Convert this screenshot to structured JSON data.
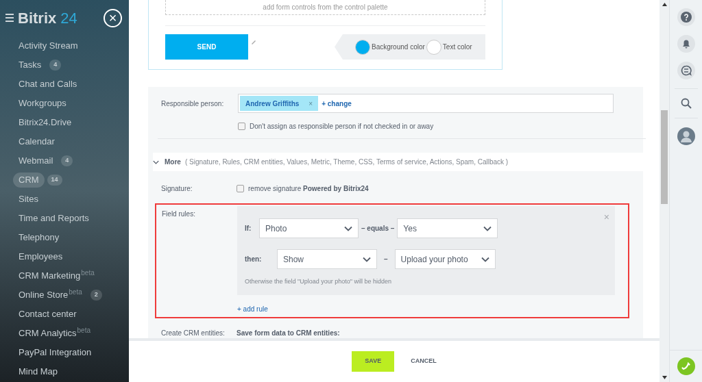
{
  "sidebar": {
    "logo_text": "Bitrix",
    "logo_number": "24",
    "close_symbol": "×",
    "items": [
      {
        "label": "Activity Stream",
        "selected": false
      },
      {
        "label": "Tasks",
        "counter": "4",
        "selected": false
      },
      {
        "label": "Chat and Calls",
        "selected": false
      },
      {
        "label": "Workgroups",
        "selected": false
      },
      {
        "label": "Bitrix24.Drive",
        "selected": false
      },
      {
        "label": "Calendar",
        "selected": false
      },
      {
        "label": "Webmail",
        "counter": "4",
        "selected": false
      },
      {
        "label": "CRM",
        "counter": "14",
        "selected": true
      },
      {
        "label": "Sites",
        "selected": false
      },
      {
        "label": "Time and Reports",
        "selected": false
      },
      {
        "label": "Telephony",
        "selected": false
      },
      {
        "label": "Employees",
        "selected": false
      },
      {
        "label": "CRM Marketing",
        "sup": "beta",
        "selected": false
      },
      {
        "label": "Online Store",
        "sup": "beta",
        "counter": "2",
        "selected": false
      },
      {
        "label": "Contact center",
        "selected": false
      },
      {
        "label": "CRM Analytics",
        "sup": "beta",
        "selected": false
      },
      {
        "label": "PayPal Integration",
        "selected": false
      },
      {
        "label": "Mind Map",
        "selected": false
      }
    ]
  },
  "form_preview": {
    "placeholder_text": "add form controls from the control palette",
    "send_button": "SEND",
    "colors": [
      {
        "label": "Background color",
        "color": "#00aeef"
      },
      {
        "label": "Text color",
        "color": "#ffffff"
      }
    ]
  },
  "responsible": {
    "label": "Responsible person:",
    "person": "Andrew Griffiths",
    "remove": "×",
    "change_link": "+ change",
    "no_assign": {
      "label": "Don't assign as responsible person if not checked in or away",
      "checked": false
    }
  },
  "more": {
    "label": "More",
    "expanded": true,
    "sections": "( Signature, Rules, CRM entities, Values, Metric, Theme, CSS, Terms of service, Actions, Spam, Callback  )"
  },
  "signature": {
    "label": "Signature:",
    "checkbox_text": "remove signature **Powered by Bitrix24**",
    "checked": false
  },
  "field_rules": {
    "label": "Field rules:",
    "close": "×",
    "rule": {
      "if_label": "If:",
      "if_field": "Photo",
      "operator": "– equals –",
      "value": "Yes",
      "then_label": "then:",
      "action": "Show",
      "dash": "–",
      "target": "Upload your photo",
      "note": "Otherwise the field \"Upload your photo\" will be hidden"
    },
    "add_rule": "+ add rule"
  },
  "crm_entities": {
    "label": "Create CRM entities:",
    "heading": "Save form data to CRM entities:"
  },
  "footer": {
    "save": "SAVE",
    "cancel": "CANCEL"
  }
}
